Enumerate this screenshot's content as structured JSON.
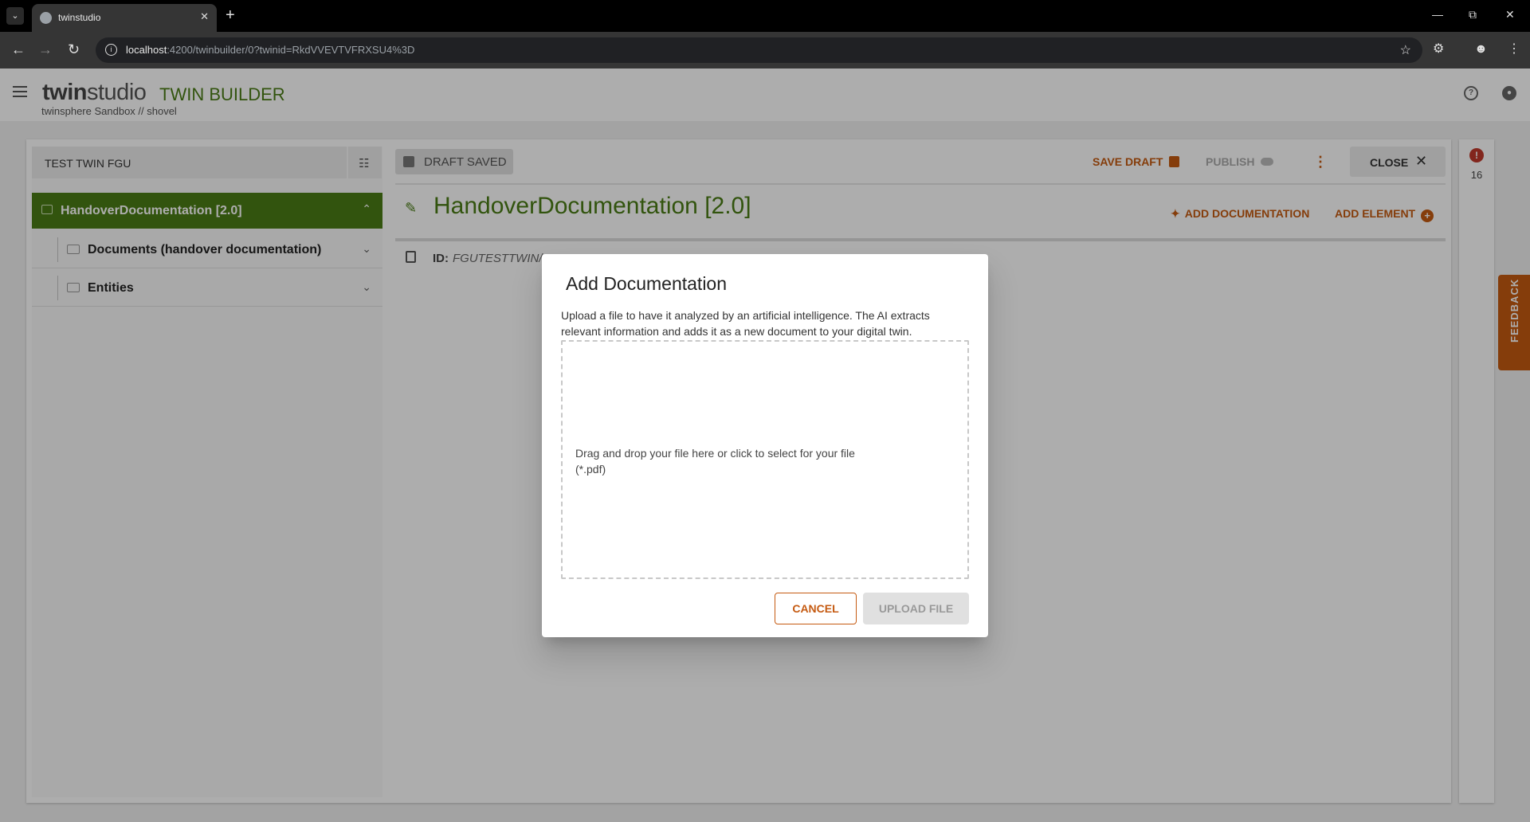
{
  "browser": {
    "tab_title": "twinstudio",
    "url_host": "localhost",
    "url_rest": ":4200/twinbuilder/0?twinid=RkdVVEVTVFRXSU4%3D"
  },
  "app": {
    "brand_bold": "twin",
    "brand_light": "studio",
    "product": "TWIN BUILDER",
    "subtitle": "twinsphere Sandbox // shovel"
  },
  "tree": {
    "twin_name": "TEST TWIN FGU",
    "root_label": "HandoverDocumentation [2.0]",
    "items": [
      {
        "label": "Documents (handover documentation)"
      },
      {
        "label": "Entities"
      }
    ]
  },
  "toolbar": {
    "draft_status": "DRAFT SAVED",
    "save_draft": "SAVE DRAFT",
    "publish": "PUBLISH",
    "close": "CLOSE"
  },
  "element": {
    "title": "HandoverDocumentation [2.0]",
    "add_documentation": "ADD DOCUMENTATION",
    "add_element": "ADD ELEMENT",
    "id_label": "ID:",
    "id_value": "FGUTESTTWIN/"
  },
  "side_panel": {
    "warning_count": "16"
  },
  "feedback": {
    "label": "FEEDBACK"
  },
  "dialog": {
    "title": "Add Documentation",
    "description": "Upload a file to have it analyzed by an artificial intelligence. The AI extracts relevant information and adds it as a new document to your digital twin.",
    "dropzone_text": "Drag and drop your file here or click to select for your file (*.pdf)",
    "cancel": "CANCEL",
    "upload": "UPLOAD FILE"
  },
  "colors": {
    "brand_green": "#4a7c16",
    "accent_orange": "#c55a11"
  }
}
